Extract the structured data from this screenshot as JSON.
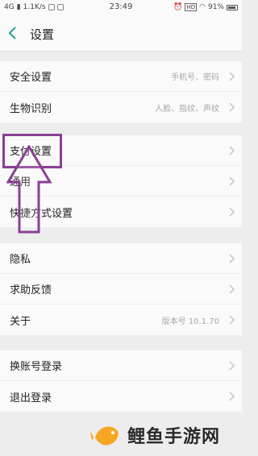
{
  "status_bar": {
    "network": "4G",
    "speed": "1.1K/s",
    "time": "23:49",
    "battery": "91%"
  },
  "header": {
    "title": "设置"
  },
  "groups": [
    {
      "items": [
        {
          "label": "安全设置",
          "value": "手机号、密码"
        },
        {
          "label": "生物识别",
          "value": "人脸、指纹、声纹"
        }
      ]
    },
    {
      "items": [
        {
          "label": "支付设置",
          "value": ""
        },
        {
          "label": "通用",
          "value": ""
        },
        {
          "label": "快捷方式设置",
          "value": ""
        }
      ]
    },
    {
      "items": [
        {
          "label": "隐私",
          "value": ""
        },
        {
          "label": "求助反馈",
          "value": ""
        },
        {
          "label": "关于",
          "value": "版本号 10.1.70"
        }
      ]
    },
    {
      "items": [
        {
          "label": "换账号登录",
          "value": ""
        },
        {
          "label": "退出登录",
          "value": ""
        }
      ]
    }
  ],
  "watermark": {
    "text": "鲤鱼手游网"
  },
  "colors": {
    "annotation": "#8a3f95",
    "logo_fish": "#f5a623"
  }
}
